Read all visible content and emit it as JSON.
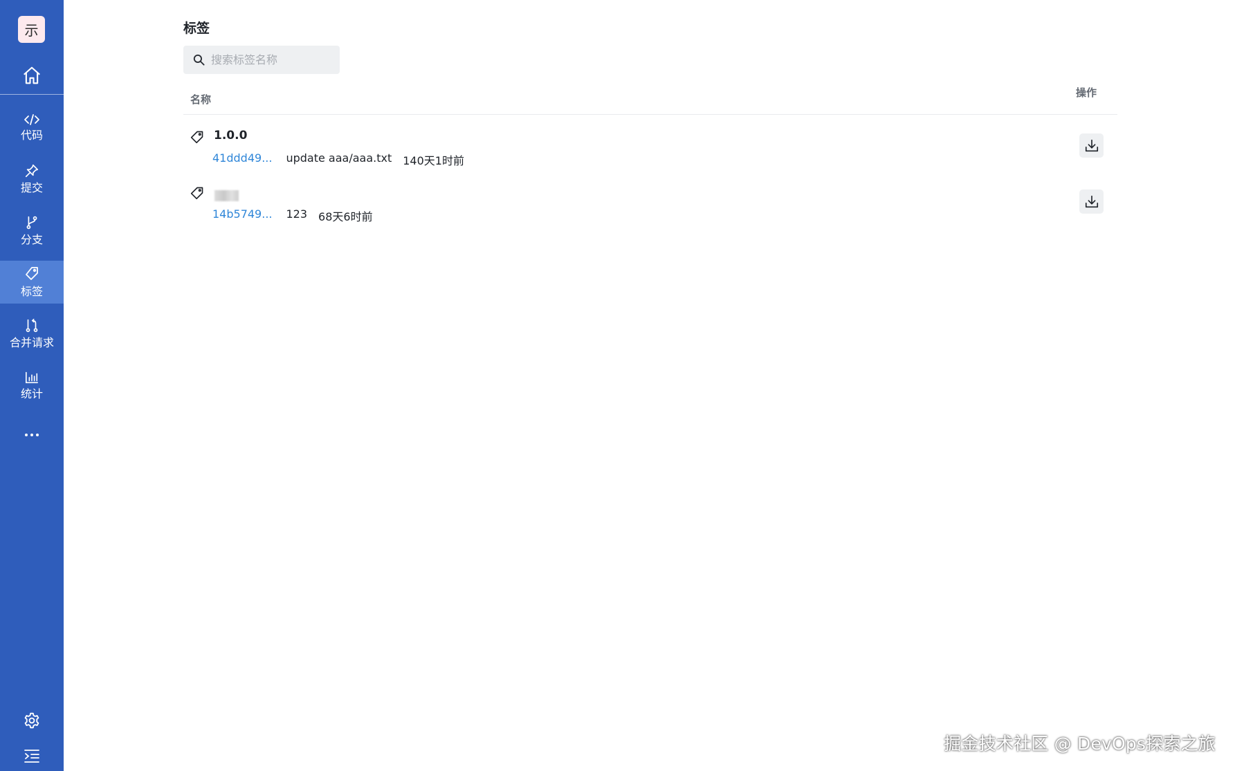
{
  "sidebar": {
    "avatar_text": "示",
    "items": [
      {
        "label": "代码",
        "icon": "code-icon",
        "active": false
      },
      {
        "label": "提交",
        "icon": "pin-icon",
        "active": false
      },
      {
        "label": "分支",
        "icon": "branch-icon",
        "active": false
      },
      {
        "label": "标签",
        "icon": "tag-icon",
        "active": true
      },
      {
        "label": "合并请求",
        "icon": "merge-request-icon",
        "active": false
      },
      {
        "label": "统计",
        "icon": "bar-chart-icon",
        "active": false
      }
    ],
    "bottom": [
      "settings-icon",
      "collapse-menu-icon"
    ]
  },
  "page": {
    "title": "标签",
    "search_placeholder": "搜索标签名称"
  },
  "table": {
    "columns": {
      "name": "名称",
      "action": "操作"
    },
    "rows": [
      {
        "name": "1.0.0",
        "name_blurred": false,
        "hash": "41ddd49...",
        "message": "update aaa/aaa.txt",
        "time": "140天1时前"
      },
      {
        "name": "",
        "name_blurred": true,
        "hash": "14b5749...",
        "message": "123",
        "time": "68天6时前"
      }
    ]
  },
  "watermark": "掘金技术社区 @ DevOps探索之旅",
  "colors": {
    "sidebar_bg": "#2f5dbb",
    "sidebar_active": "#5180d6",
    "link": "#2f86d8",
    "button_bg": "#eef0f2"
  }
}
